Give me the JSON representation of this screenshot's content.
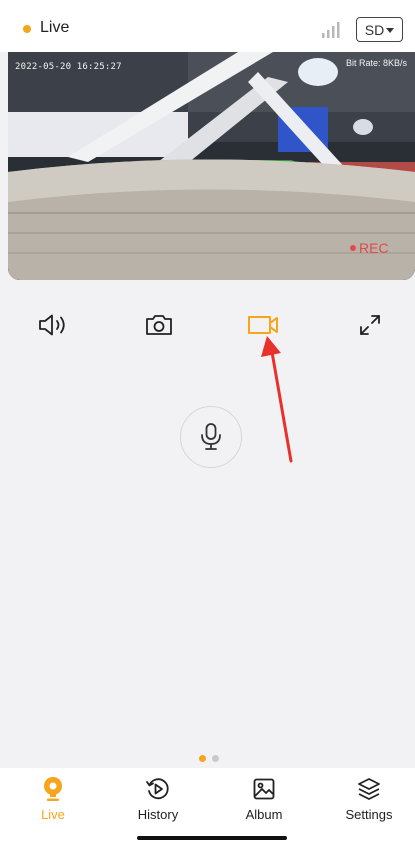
{
  "header": {
    "title": "Live",
    "status_color": "#f7a51c",
    "signal_icon": "signal-bars-icon",
    "quality_label": "SD"
  },
  "video": {
    "timestamp": "2022-05-20 16:25:27",
    "bitrate": "Bit Rate: 8KB/s",
    "rec_label": "REC"
  },
  "controls": [
    {
      "name": "sound-button",
      "icon": "speaker-icon",
      "active": false
    },
    {
      "name": "snapshot-button",
      "icon": "camera-icon",
      "active": false
    },
    {
      "name": "record-button",
      "icon": "video-camera-icon",
      "active": true
    },
    {
      "name": "fullscreen-button",
      "icon": "expand-icon",
      "active": false
    }
  ],
  "talk": {
    "icon": "microphone-icon"
  },
  "pager": {
    "count": 2,
    "active": 0
  },
  "tabs": [
    {
      "label": "Live",
      "icon": "live-pin-icon",
      "active": true
    },
    {
      "label": "History",
      "icon": "history-icon",
      "active": false
    },
    {
      "label": "Album",
      "icon": "album-icon",
      "active": false
    },
    {
      "label": "Settings",
      "icon": "settings-icon",
      "active": false
    }
  ],
  "colors": {
    "accent": "#f7a51c",
    "rec": "#e24b4b",
    "annotation": "#e8312a"
  }
}
